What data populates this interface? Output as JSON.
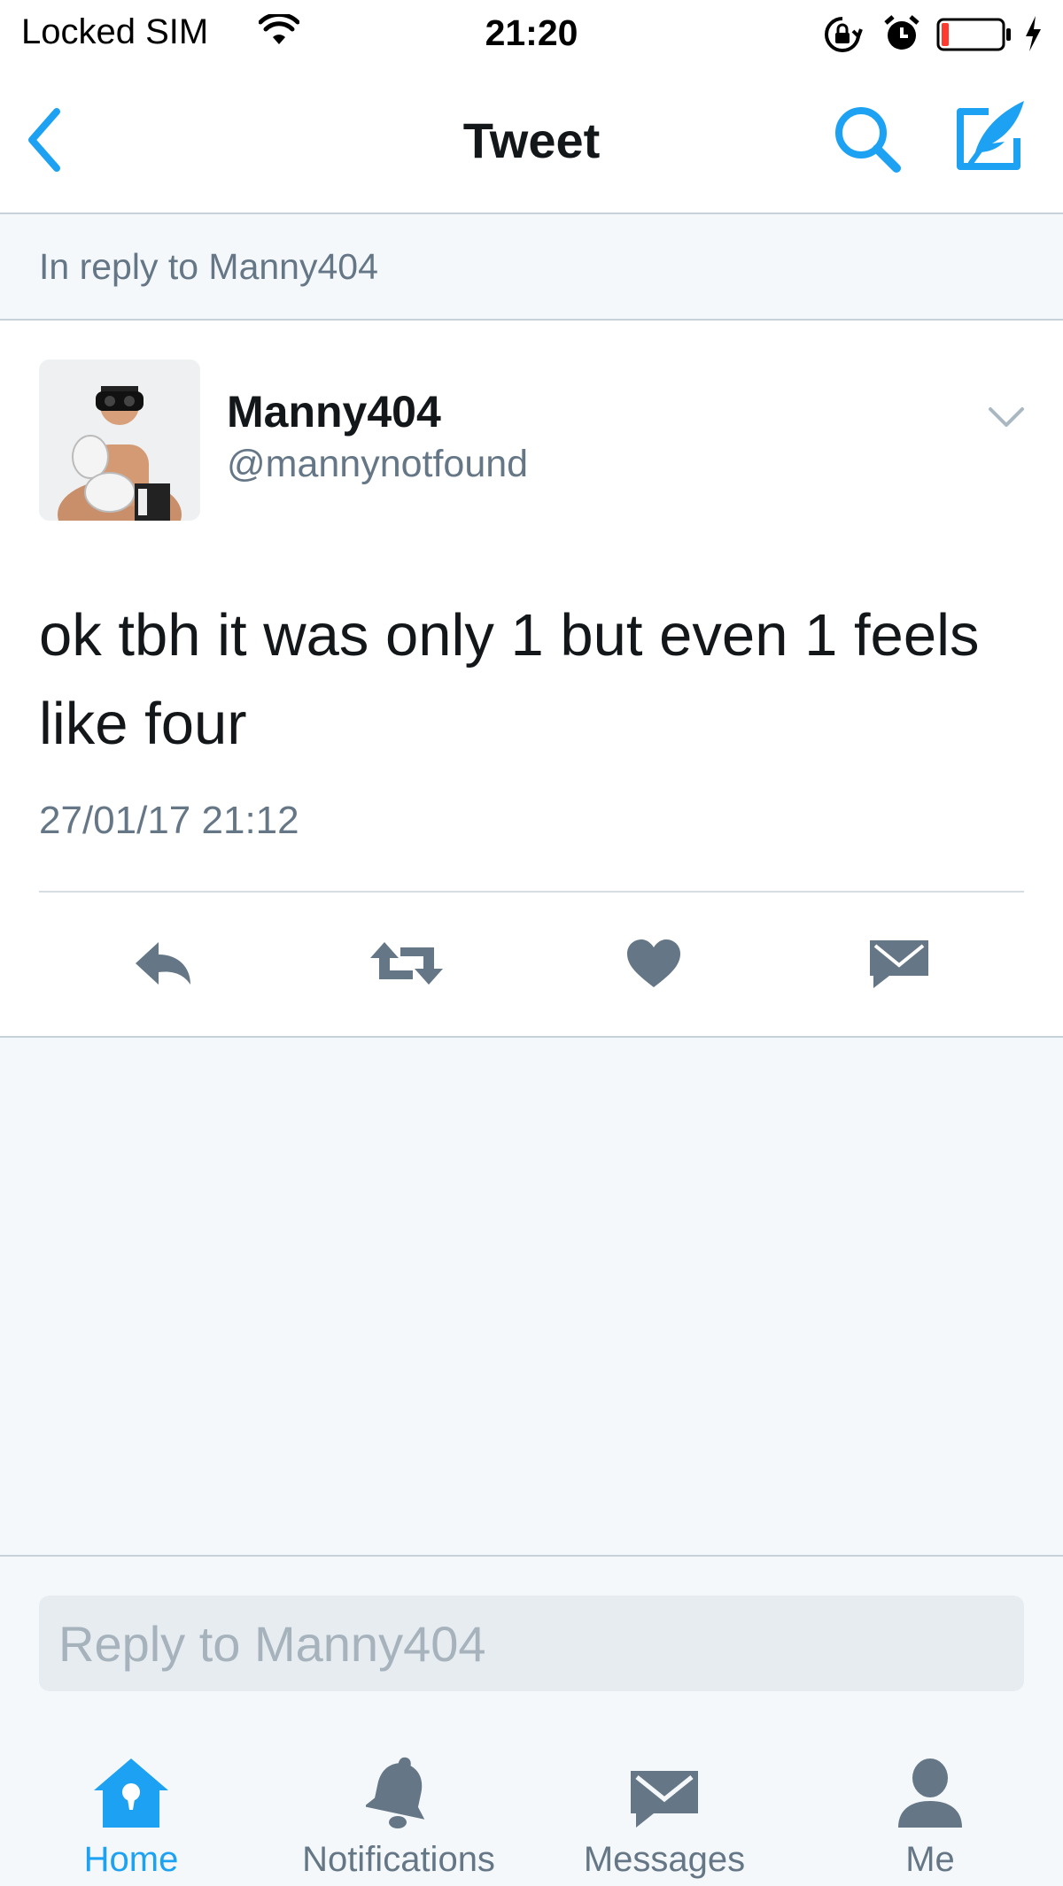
{
  "status_bar": {
    "carrier": "Locked SIM",
    "time": "21:20",
    "battery_level": 0.12,
    "icons": [
      "wifi-icon",
      "rotation-lock-icon",
      "alarm-icon",
      "battery-icon",
      "charging-bolt-icon"
    ]
  },
  "nav": {
    "title": "Tweet",
    "icons": [
      "back-chevron-icon",
      "search-icon",
      "compose-tweet-icon"
    ]
  },
  "reply_banner": {
    "text": "In reply to Manny404"
  },
  "tweet": {
    "display_name": "Manny404",
    "handle": "@mannynotfound",
    "text": "ok tbh it was only 1 but even 1 feels like four",
    "timestamp": "27/01/17 21:12",
    "actions": [
      "reply-icon",
      "retweet-icon",
      "like-icon",
      "direct-message-icon"
    ]
  },
  "composer": {
    "placeholder": "Reply to Manny404"
  },
  "tab_bar": {
    "items": [
      {
        "label": "Home",
        "icon": "home-icon",
        "active": true
      },
      {
        "label": "Notifications",
        "icon": "bell-icon",
        "active": false
      },
      {
        "label": "Messages",
        "icon": "envelope-icon",
        "active": false
      },
      {
        "label": "Me",
        "icon": "person-icon",
        "active": false
      }
    ]
  },
  "colors": {
    "accent": "#1da1f2",
    "text_primary": "#14171a",
    "text_secondary": "#657786",
    "icon_gray": "#657786",
    "background_gray": "#f5f8fa",
    "battery_low": "#ff3b30"
  }
}
